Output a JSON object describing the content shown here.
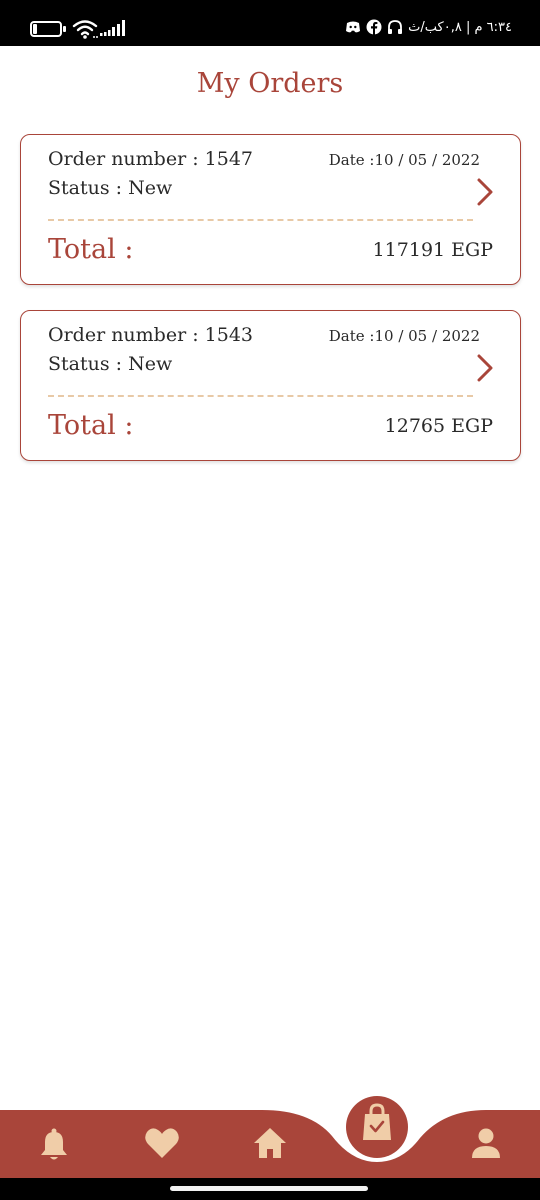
{
  "status_bar": {
    "battery_level": "12",
    "right_text": "٦:٣٤ م | ٠,٨كب/ث",
    "icons": [
      "wifi-icon",
      "signal-icon",
      "headset-icon",
      "facebook-icon",
      "discord-icon"
    ]
  },
  "page": {
    "title": "My Orders"
  },
  "orders": [
    {
      "number_label": "Order number : 1547",
      "date_label": "Date :10 / 05 / 2022",
      "status_label": "Status : New",
      "total_label": "Total :",
      "total_value": "117191 EGP"
    },
    {
      "number_label": "Order number : 1543",
      "date_label": "Date :10 / 05 / 2022",
      "status_label": "Status : New",
      "total_label": "Total :",
      "total_value": "12765 EGP"
    }
  ],
  "bottom_nav": {
    "items": [
      "notifications-icon",
      "favorites-icon",
      "home-icon",
      "orders-bag-icon",
      "profile-icon"
    ],
    "active": "orders-bag-icon"
  },
  "colors": {
    "accent": "#a9453a",
    "icon_tint": "#f0cda8",
    "divider": "#e8c9a6"
  }
}
